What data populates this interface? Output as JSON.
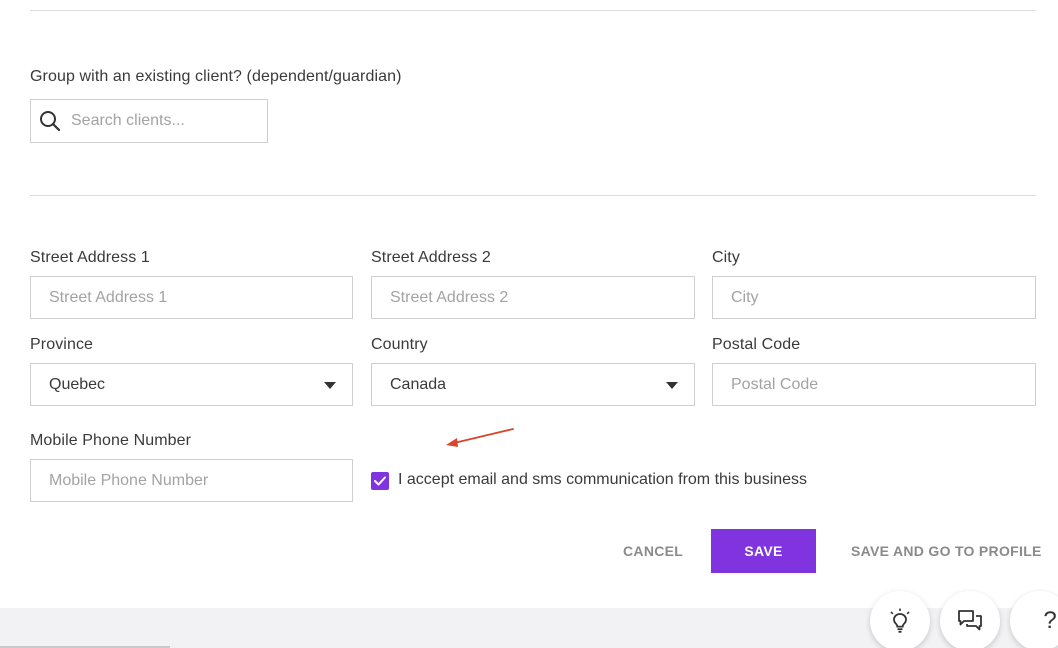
{
  "group": {
    "label": "Group with an existing client? (dependent/guardian)",
    "search_placeholder": "Search clients..."
  },
  "address": {
    "street1_label": "Street Address 1",
    "street1_placeholder": "Street Address 1",
    "street2_label": "Street Address 2",
    "street2_placeholder": "Street Address 2",
    "city_label": "City",
    "city_placeholder": "City",
    "province_label": "Province",
    "province_value": "Quebec",
    "country_label": "Country",
    "country_value": "Canada",
    "postal_label": "Postal Code",
    "postal_placeholder": "Postal Code"
  },
  "phone": {
    "label": "Mobile Phone Number",
    "placeholder": "Mobile Phone Number"
  },
  "consent": {
    "text": "I accept email and sms communication from this business",
    "checked": true
  },
  "actions": {
    "cancel_label": "CANCEL",
    "save_label": "SAVE",
    "save_go_label": "SAVE AND GO TO PROFILE"
  },
  "help_buttons": {
    "help_symbol": "?"
  },
  "icons": [
    "search-icon",
    "lightbulb-icon",
    "chat-icon",
    "help-icon",
    "check-icon",
    "chevron-down-icon",
    "arrow-annotation"
  ],
  "colors": {
    "accent": "#8034e0",
    "annotation_arrow": "#d9442b"
  }
}
